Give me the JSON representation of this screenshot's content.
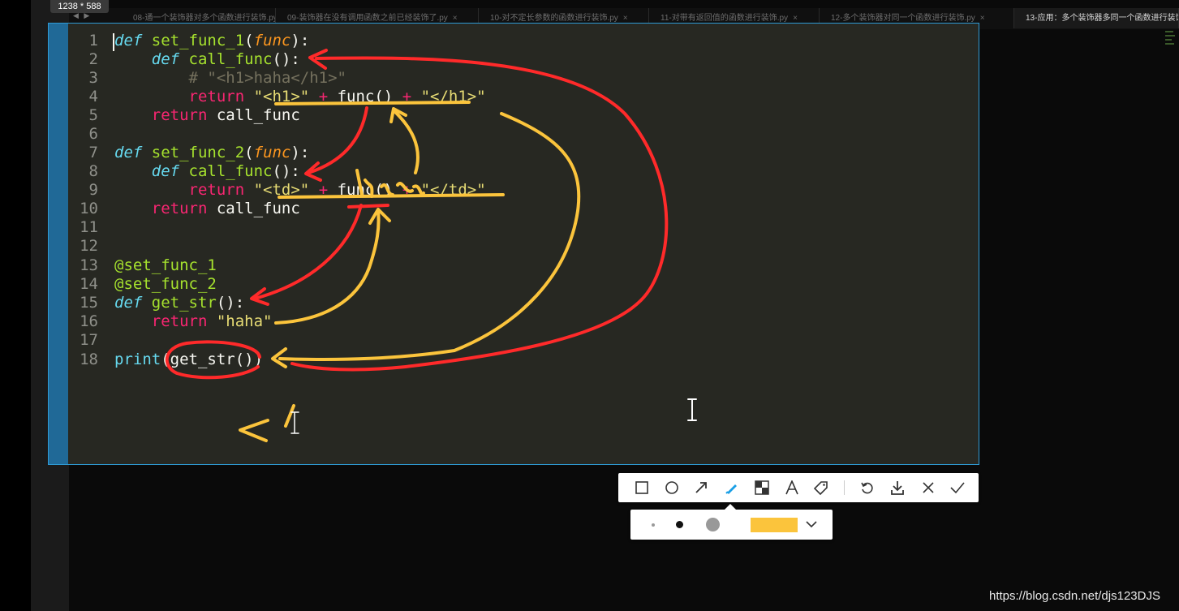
{
  "screenshot_size_badge": "1238 * 588",
  "nav_arrows": "◀ ▶",
  "tabs": [
    {
      "label": "08-通一个装饰器对多个函数进行装饰.py",
      "close": "×"
    },
    {
      "label": "09-装饰器在没有调用函数之前已经装饰了.py",
      "close": "×"
    },
    {
      "label": "10-对不定长参数的函数进行装饰.py",
      "close": "×"
    },
    {
      "label": "11-对带有返回值的函数进行装饰.py",
      "close": "×"
    },
    {
      "label": "12-多个装饰器对同一个函数进行装饰.py",
      "close": "×"
    },
    {
      "label": "13-应用：多个装饰器多同一个函数进行装饰",
      "close": ""
    }
  ],
  "code": {
    "line_numbers": [
      "1",
      "2",
      "3",
      "4",
      "5",
      "6",
      "7",
      "8",
      "9",
      "10",
      "11",
      "12",
      "13",
      "14",
      "15",
      "16",
      "17",
      "18"
    ],
    "l1": {
      "kw": "def",
      "name": "set_func_1",
      "open": "(",
      "arg": "func",
      "close": "):"
    },
    "l2": {
      "kw": "def",
      "name": "call_func",
      "rest": "():"
    },
    "l3": {
      "comment": "# \"<h1>haha</h1>\""
    },
    "l4": {
      "kw": "return",
      "s1": "\"<h1>\"",
      "plus1": "+",
      "call": "func()",
      "plus2": "+",
      "s2": "\"</h1>\""
    },
    "l5": {
      "kw": "return",
      "rest": "call_func"
    },
    "l7": {
      "kw": "def",
      "name": "set_func_2",
      "open": "(",
      "arg": "func",
      "close": "):"
    },
    "l8": {
      "kw": "def",
      "name": "call_func",
      "rest": "():"
    },
    "l9": {
      "kw": "return",
      "s1": "\"<td>\"",
      "plus1": "+",
      "call": "func()",
      "plus2": "+",
      "s2": "\"</td>\""
    },
    "l10": {
      "kw": "return",
      "rest": "call_func"
    },
    "l13": {
      "dec": "@set_func_1"
    },
    "l14": {
      "dec": "@set_func_2"
    },
    "l15": {
      "kw": "def",
      "name": "get_str",
      "rest": "():"
    },
    "l16": {
      "kw": "return",
      "s": "\"haha\""
    },
    "l18": {
      "fn": "print",
      "rest": "(get_str())"
    }
  },
  "toolbar": {
    "tools": [
      "rectangle-tool",
      "ellipse-tool",
      "arrow-tool",
      "pen-tool",
      "mosaic-tool",
      "text-tool",
      "tag-tool",
      "undo",
      "download",
      "cancel",
      "confirm"
    ],
    "active_tool": "pen-tool",
    "accent": "#1a9fe6"
  },
  "brush": {
    "sizes": [
      "small",
      "medium",
      "large"
    ],
    "selected_size": "medium",
    "color": "#fbc43c"
  },
  "colors": {
    "red_annotation": "#ff2a2a",
    "yellow_annotation": "#fbc43c",
    "selection_border": "#2e9bd6"
  },
  "watermark": "https://blog.csdn.net/djs123DJS"
}
